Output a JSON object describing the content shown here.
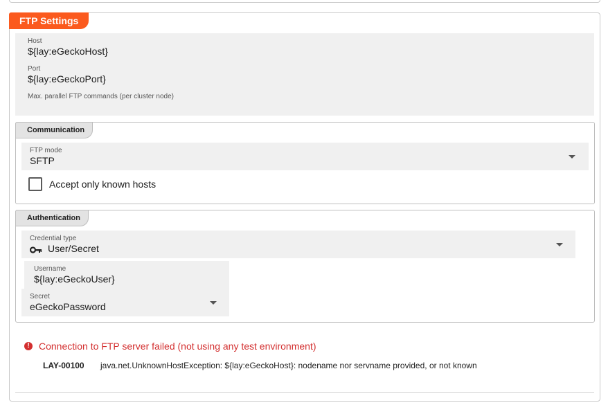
{
  "section": {
    "title": "FTP Settings"
  },
  "host": {
    "label": "Host",
    "value": "${lay:eGeckoHost}"
  },
  "port": {
    "label": "Port",
    "value": "${lay:eGeckoPort}"
  },
  "parallel": {
    "label": "Max. parallel FTP commands (per cluster node)",
    "value": ""
  },
  "communication": {
    "title": "Communication",
    "ftp_mode": {
      "label": "FTP mode",
      "value": "SFTP"
    },
    "known_hosts": {
      "label": "Accept only known hosts",
      "checked": false
    }
  },
  "authentication": {
    "title": "Authentication",
    "credential_type": {
      "label": "Credential type",
      "value": "User/Secret",
      "icon": "key-icon"
    },
    "username": {
      "label": "Username",
      "value": "${lay:eGeckoUser}"
    },
    "secret": {
      "label": "Secret",
      "value": "eGeckoPassword"
    }
  },
  "error": {
    "message": "Connection to FTP server failed (not using any test environment)",
    "code": "LAY-00100",
    "detail": "java.net.UnknownHostException: ${lay:eGeckoHost}: nodename nor servname provided, or not known",
    "color": "#d32f2f"
  },
  "colors": {
    "accent": "#fb5a1e",
    "field_bg": "#f0f0f0",
    "error": "#d32f2f"
  }
}
